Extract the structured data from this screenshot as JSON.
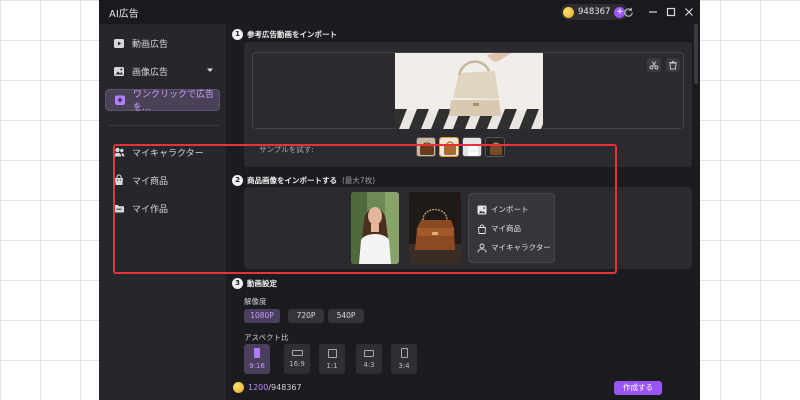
{
  "window": {
    "title": "AI広告"
  },
  "titlebar": {
    "credits_value": "948367",
    "plus_symbol": "+",
    "icons": [
      "refresh-icon",
      "minimize-icon",
      "maximize-icon",
      "close-icon"
    ]
  },
  "sidebar": {
    "items": [
      {
        "label": "動画広告",
        "icon": "video-ad-icon"
      },
      {
        "label": "画像広告",
        "icon": "image-ad-icon",
        "has_caret": true
      },
      {
        "label": "ワンクリックで広告を...",
        "icon": "one-click-ad-icon",
        "active": true
      },
      {
        "label": "マイキャラクター",
        "icon": "my-characters-icon"
      },
      {
        "label": "マイ商品",
        "icon": "my-products-icon"
      },
      {
        "label": "マイ作品",
        "icon": "my-works-icon"
      }
    ]
  },
  "steps": {
    "step1": {
      "num": "1",
      "title": "参考広告動画をインポート"
    },
    "step2": {
      "num": "2",
      "title": "商品画像をインポートする",
      "hint": "(最大7枚)"
    },
    "step3": {
      "num": "3",
      "title": "動画設定"
    }
  },
  "reference": {
    "sample_label": "サンプルを試す:",
    "samples": [
      "bag-sample",
      "bag-sample-2",
      "white-sample",
      "dark-sample"
    ],
    "selected_sample_index": 1,
    "tool_icons": [
      "scissors-icon",
      "trash-icon"
    ]
  },
  "import_menu": {
    "import_label": "インポート",
    "my_products_label": "マイ商品",
    "my_characters_label": "マイキャラクター"
  },
  "settings": {
    "resolution_label": "解像度",
    "resolutions": [
      "1080P",
      "720P",
      "540P"
    ],
    "selected_resolution": "1080P",
    "aspect_label": "アスペクト比",
    "aspects": [
      "9:16",
      "16:9",
      "1:1",
      "4:3",
      "3:4"
    ],
    "selected_aspect": "9:16"
  },
  "footer": {
    "cost_used": "1200",
    "cost_total": "/948367",
    "create_label": "作成する"
  },
  "colors": {
    "accent": "#9b55f5",
    "highlight": "#e8323a",
    "window_bg": "#1c1c20",
    "sidebar_bg": "#26262b"
  }
}
